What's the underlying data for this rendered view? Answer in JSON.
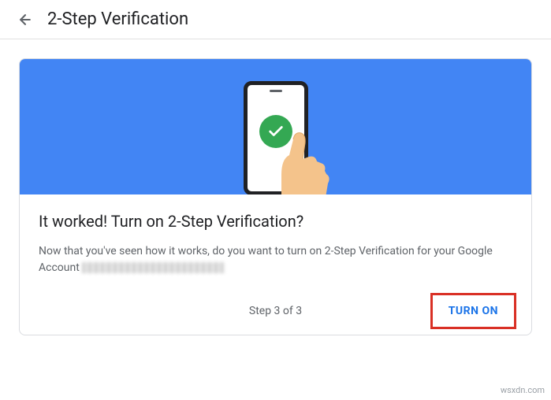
{
  "header": {
    "title": "2-Step Verification"
  },
  "card": {
    "title": "It worked! Turn on 2-Step Verification?",
    "body_prefix": "Now that you've seen how it works, do you want to turn on 2-Step Verification for your Google Account ",
    "step_label": "Step 3 of 3",
    "turn_on_label": "TURN ON"
  },
  "watermark": "wsxdn.com"
}
